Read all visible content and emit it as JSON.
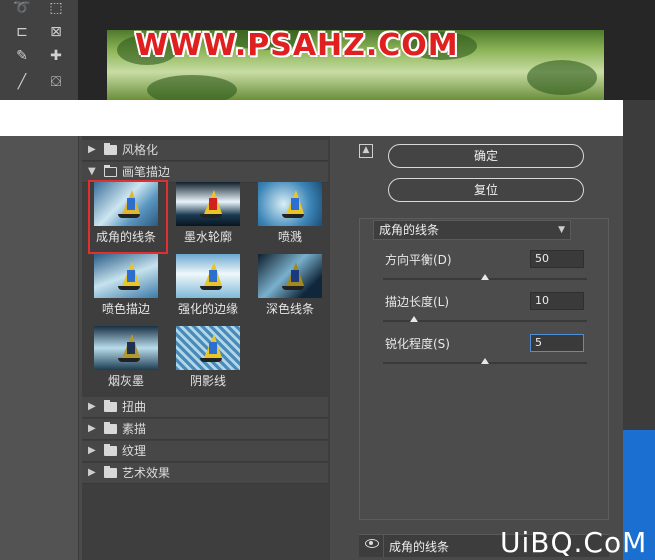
{
  "watermark": "WWW.PSAHZ.COM",
  "brand": "UiBQ.CoM",
  "tools": [
    {
      "name": "lasso-tool-icon",
      "glyph": "➰"
    },
    {
      "name": "move-select-tool-icon",
      "glyph": "⬚"
    },
    {
      "name": "crop-tool-icon",
      "glyph": "⊏"
    },
    {
      "name": "frame-tool-icon",
      "glyph": "⊠"
    },
    {
      "name": "eyedropper-tool-icon",
      "glyph": "✎"
    },
    {
      "name": "healing-brush-icon",
      "glyph": "✚"
    },
    {
      "name": "brush-tool-icon",
      "glyph": "╱"
    },
    {
      "name": "stamp-tool-icon",
      "glyph": "⛋"
    }
  ],
  "categories": {
    "stylize": "风格化",
    "brush_strokes": "画笔描边",
    "distort": "扭曲",
    "sketch": "素描",
    "texture": "纹理",
    "artistic": "艺术效果"
  },
  "thumbnails": [
    "成角的线条",
    "墨水轮廓",
    "喷溅",
    "喷色描边",
    "强化的边缘",
    "深色线条",
    "烟灰墨",
    "阴影线"
  ],
  "buttons": {
    "ok": "确定",
    "reset": "复位"
  },
  "filter_select": {
    "value": "成角的线条"
  },
  "params": [
    {
      "label": "方向平衡(D)",
      "value": "50",
      "level_percent": 50
    },
    {
      "label": "描边长度(L)",
      "value": "10",
      "level_percent": 15
    },
    {
      "label": "锐化程度(S)",
      "value": "5",
      "level_percent": 50
    }
  ],
  "layer": {
    "name": "成角的线条"
  }
}
